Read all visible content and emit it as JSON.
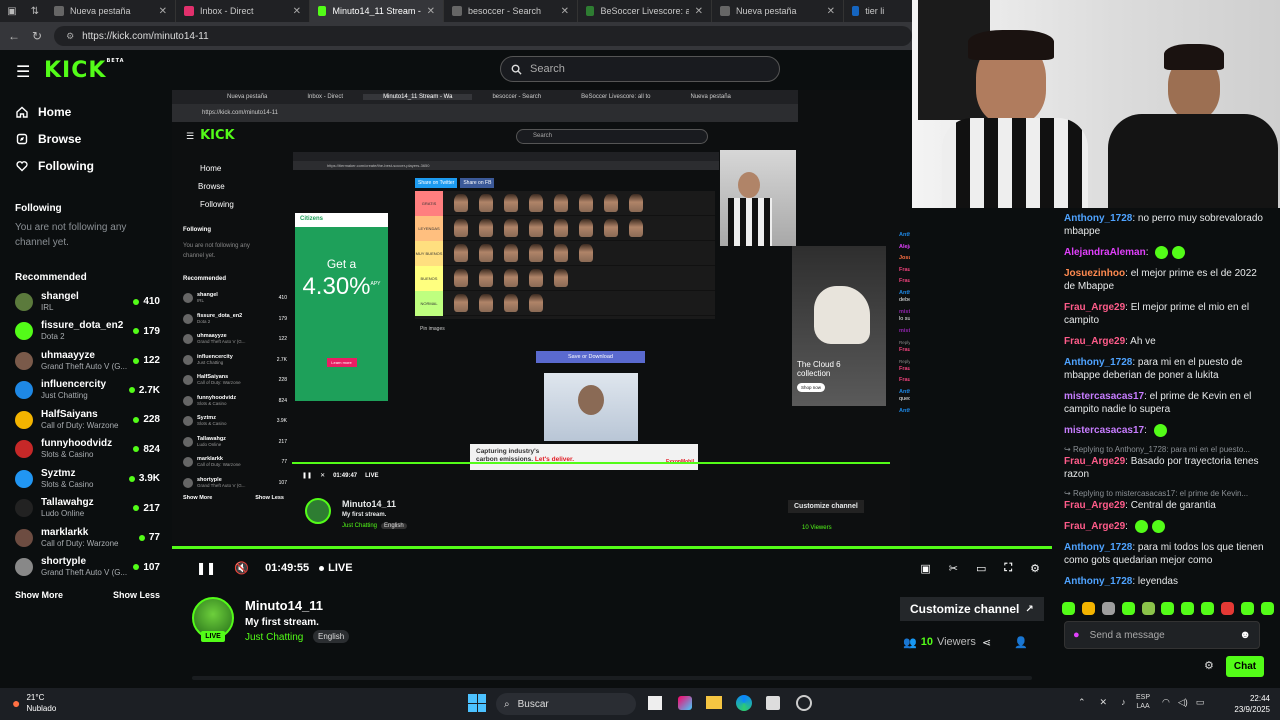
{
  "browser": {
    "tabs": [
      {
        "label": "Nueva pestaña",
        "color": "#888"
      },
      {
        "label": "Inbox - Direct",
        "color": "#e1306c"
      },
      {
        "label": "Minuto14_11 Stream - Wa",
        "color": "#53fc18",
        "active": true
      },
      {
        "label": "besoccer - Search",
        "color": "#888"
      },
      {
        "label": "BeSoccer Livescore: all to",
        "color": "#2e7d32"
      },
      {
        "label": "Nueva pestaña",
        "color": "#888"
      },
      {
        "label": "tier list",
        "color": "#1565c0"
      }
    ],
    "url": "https://kick.com/minuto14-11"
  },
  "header": {
    "logo": "KICK",
    "logo_badge": "BETA",
    "search_placeholder": "Search"
  },
  "sidebar": {
    "nav": [
      {
        "label": "Home",
        "icon": "home-icon"
      },
      {
        "label": "Browse",
        "icon": "compass-icon"
      },
      {
        "label": "Following",
        "icon": "heart-icon"
      }
    ],
    "following_title": "Following",
    "following_empty": "You are not following any channel yet.",
    "recommended_title": "Recommended",
    "recommended": [
      {
        "name": "shangel",
        "category": "IRL",
        "viewers": "410",
        "color": "#5b7a3c"
      },
      {
        "name": "fissure_dota_en2",
        "category": "Dota 2",
        "viewers": "179",
        "color": "#53fc18"
      },
      {
        "name": "uhmaayyze",
        "category": "Grand Theft Auto V (G...",
        "viewers": "122",
        "color": "#7a5a4a"
      },
      {
        "name": "influencercity",
        "category": "Just Chatting",
        "viewers": "2.7K",
        "color": "#1e88e5"
      },
      {
        "name": "HalfSaiyans",
        "category": "Call of Duty: Warzone",
        "viewers": "228",
        "color": "#f4b400"
      },
      {
        "name": "funnyhoodvidz",
        "category": "Slots & Casino",
        "viewers": "824",
        "color": "#c62828"
      },
      {
        "name": "Syztmz",
        "category": "Slots & Casino",
        "viewers": "3.9K",
        "color": "#2196f3"
      },
      {
        "name": "Tallawahgz",
        "category": "Ludo Online",
        "viewers": "217",
        "color": "#222"
      },
      {
        "name": "marklarkk",
        "category": "Call of Duty: Warzone",
        "viewers": "77",
        "color": "#6d4c41"
      },
      {
        "name": "shortyple",
        "category": "Grand Theft Auto V (G...",
        "viewers": "107",
        "color": "#888"
      }
    ],
    "show_more": "Show More",
    "show_less": "Show Less"
  },
  "inner": {
    "tabs": [
      "Nueva pestaña",
      "Inbox - Direct",
      "Minuto14_11 Stream - Wa",
      "besoccer - Search",
      "BeSoccer Livescore: all to",
      "Nueva pestaña",
      "tier list"
    ],
    "url": "https://kick.com/minuto14-11",
    "nav": [
      "Home",
      "Browse",
      "Following"
    ],
    "following_title": "Following",
    "following_empty": "You are not following any channel yet.",
    "recommended_title": "Recommended",
    "recommended": [
      {
        "name": "shangel",
        "category": "IRL",
        "viewers": "410"
      },
      {
        "name": "fissure_dota_en2",
        "category": "Dota 2",
        "viewers": "179"
      },
      {
        "name": "uhmaayyze",
        "category": "Grand Theft Auto V (G...",
        "viewers": "122"
      },
      {
        "name": "influencercity",
        "category": "Just Chatting",
        "viewers": "2.7K"
      },
      {
        "name": "HalfSaiyans",
        "category": "Call of Duty: Warzone",
        "viewers": "228"
      },
      {
        "name": "funnyhoodvidz",
        "category": "Slots & Casino",
        "viewers": "824"
      },
      {
        "name": "Syztmz",
        "category": "Slots & Casino",
        "viewers": "3.9K"
      },
      {
        "name": "Tallawahgz",
        "category": "Ludo Online",
        "viewers": "217"
      },
      {
        "name": "marklarkk",
        "category": "Call of Duty: Warzone",
        "viewers": "77"
      },
      {
        "name": "shortyple",
        "category": "Grand Theft Auto V (G...",
        "viewers": "107"
      }
    ],
    "show_more": "Show More",
    "show_less": "Show Less",
    "search": "Search",
    "tier_url": "https://tiermaker.com/create/the-best-soccer-players-3650",
    "share_twitter": "Share on Twitter",
    "share_fb": "Share on FB",
    "tier_labels": [
      "GRATIS",
      "LEYENDAS",
      "MUY BUENOS",
      "BUENOS",
      "NORMAL"
    ],
    "pin_images": "Pin images",
    "save_btn": "Save or Download",
    "ad_brand": "Citizens",
    "ad_headline": "Get a",
    "ad_rate": "4.30%",
    "ad_apy": "APY",
    "ad_cta": "Learn more",
    "banner_line1": "Capturing industry's",
    "banner_line2": "carbon emissions.",
    "banner_cta": "Let's deliver.",
    "banner_brand": "ExxonMobil",
    "shoe_title": "The Cloud 6 collection",
    "shoe_cta": "Shop now",
    "time": "01:49:47",
    "live": "LIVE",
    "channel": "Minuto14_11",
    "stream_title": "My first stream.",
    "category": "Just Chatting",
    "language": "English",
    "customize": "Customize channel",
    "viewers": "10 Viewers",
    "send_placeholder": "Send a message",
    "chat": [
      {
        "user": "Anthony_1728",
        "text": "no perro muy sobrevalorado mbappe",
        "color": "#1e88e5"
      },
      {
        "user": "AlejandraAleman",
        "text": "",
        "color": "#e040fb"
      },
      {
        "user": "Josuezinhoo",
        "text": "el mejor prime es el de 2022 de Mbappe",
        "color": "#ff7043"
      },
      {
        "user": "Frau_Arge29",
        "text": "El mejor prime el mio en el campito",
        "color": "#ec407a"
      },
      {
        "user": "Frau_Arge29",
        "text": "Ah ve",
        "color": "#ec407a"
      },
      {
        "user": "Anthony_1728",
        "text": "para mi en el puesto de mbappe deberian de poner a lukita",
        "color": "#1e88e5"
      },
      {
        "user": "mistercasacas17",
        "text": "el prime de Kevin en el campito nadie lo supera",
        "color": "#8e24aa"
      },
      {
        "user": "mistercasacas17",
        "text": "",
        "color": "#8e24aa"
      },
      {
        "user": "Frau_Arge29",
        "text": "Basado por trayectoria tenes razon",
        "color": "#ec407a",
        "reply": "Replying to Anthony_1728: para mi en el puesto..."
      },
      {
        "user": "Frau_Arge29",
        "text": "Central de garantia",
        "color": "#ec407a",
        "reply": "Replying to mistercasacas17: el prime de Kevin..."
      },
      {
        "user": "Frau_Arge29",
        "text": "",
        "color": "#ec407a"
      },
      {
        "user": "Anthony_1728",
        "text": "para mi todos los que tienen como gots quedarian mejor como",
        "color": "#1e88e5"
      },
      {
        "user": "Anthony_1728",
        "text": "leyendas",
        "color": "#1e88e5"
      }
    ]
  },
  "chat": {
    "messages": [
      {
        "user": "Anthony_1728",
        "text": "no perro muy sobrevalorado mbappe",
        "color": "#4fa3ff"
      },
      {
        "user": "AlejandraAleman",
        "text": "",
        "color": "#e040fb",
        "emotes": 2
      },
      {
        "user": "Josuezinhoo",
        "text": "el mejor prime es el de 2022 de Mbappe",
        "color": "#ff8a50"
      },
      {
        "user": "Frau_Arge29",
        "text": "El mejor prime el mio en el campito",
        "color": "#ff5c8a"
      },
      {
        "user": "Frau_Arge29",
        "text": "Ah ve",
        "color": "#ff5c8a"
      },
      {
        "user": "Anthony_1728",
        "text": "para mi en el puesto de mbappe deberian de poner a lukita",
        "color": "#4fa3ff"
      },
      {
        "user": "mistercasacas17",
        "text": "el prime de Kevin en el campito nadie lo supera",
        "color": "#c77dff"
      },
      {
        "user": "mistercasacas17",
        "text": "",
        "color": "#c77dff",
        "emotes": 1
      },
      {
        "user": "Frau_Arge29",
        "text": "Basado por trayectoria tenes razon",
        "color": "#ff5c8a",
        "reply": "Replying to Anthony_1728: para mi en el puesto..."
      },
      {
        "user": "Frau_Arge29",
        "text": "Central de garantia",
        "color": "#ff5c8a",
        "reply": "Replying to mistercasacas17: el prime de Kevin..."
      },
      {
        "user": "Frau_Arge29",
        "text": "",
        "color": "#ff5c8a",
        "emotes": 2
      },
      {
        "user": "Anthony_1728",
        "text": "para mi todos los que tienen como gots quedarian mejor como",
        "color": "#4fa3ff"
      },
      {
        "user": "Anthony_1728",
        "text": "leyendas",
        "color": "#4fa3ff"
      }
    ],
    "send_placeholder": "Send a message",
    "chat_button": "Chat"
  },
  "player": {
    "time": "01:49:55",
    "live": "LIVE"
  },
  "channel": {
    "name": "Minuto14_11",
    "title": "My first stream.",
    "category": "Just Chatting",
    "language": "English",
    "live_badge": "LIVE",
    "customize": "Customize channel",
    "viewers_count": "10",
    "viewers_label": "Viewers"
  },
  "taskbar": {
    "weather_temp": "21°C",
    "weather_desc": "Nublado",
    "search": "Buscar",
    "lang": "ESP",
    "layout": "LAA",
    "time": "22:44",
    "date": "23/9/2025"
  },
  "colors": {
    "accent": "#53fc18",
    "bg": "#0b0e0f"
  }
}
